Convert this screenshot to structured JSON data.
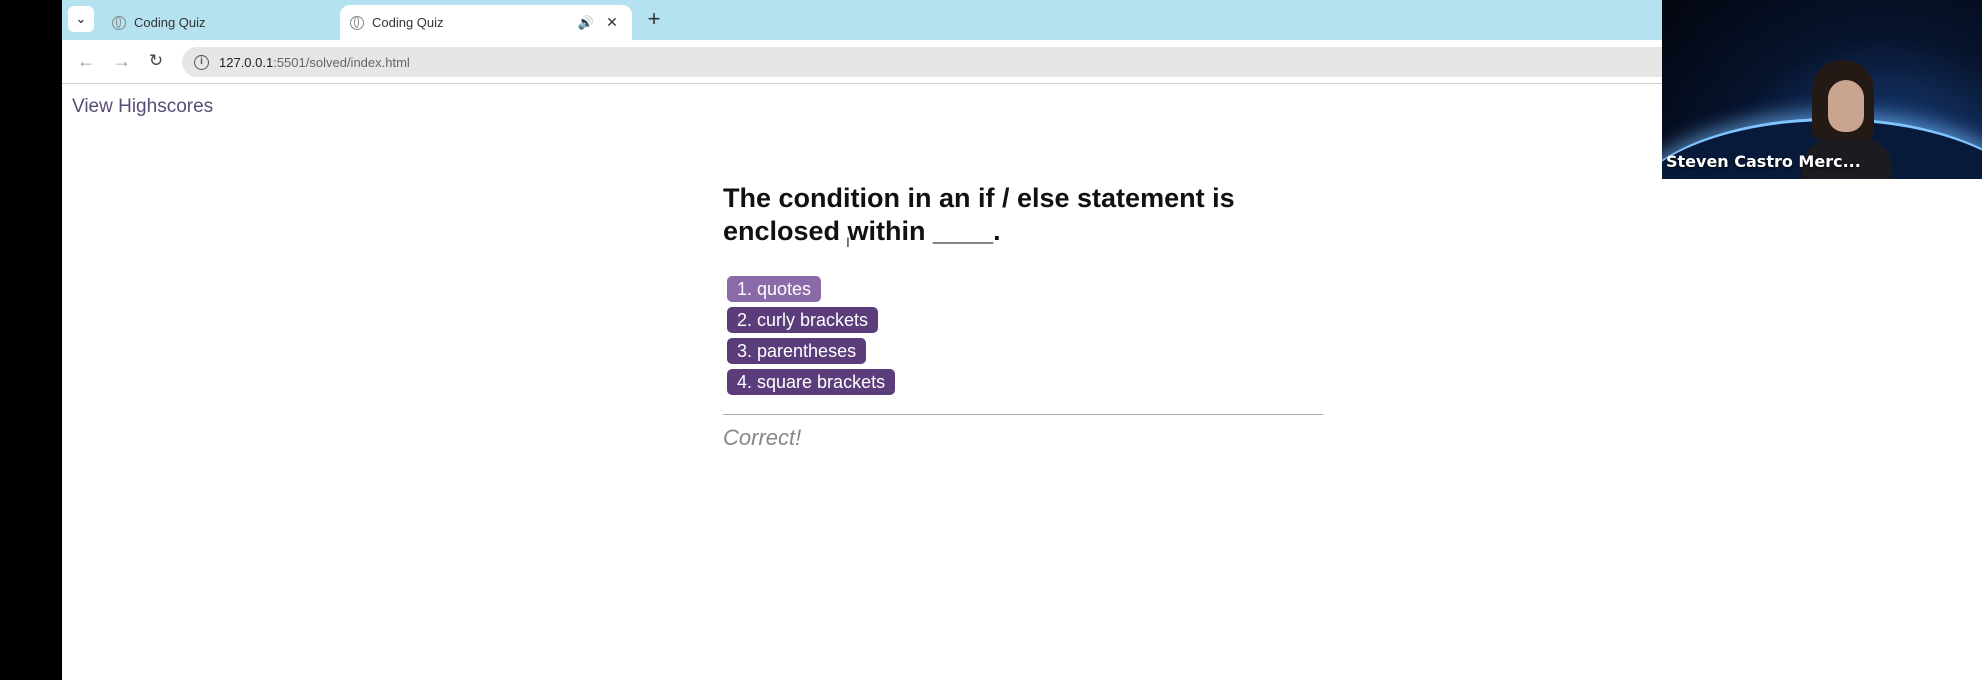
{
  "browser": {
    "tabs": [
      {
        "title": "Coding Quiz",
        "active": false
      },
      {
        "title": "Coding Quiz",
        "active": true
      }
    ],
    "address": {
      "host": "127.0.0.1",
      "path": ":5501/solved/index.html"
    }
  },
  "page": {
    "highscores_link": "View Highscores",
    "question": "The condition in an if / else statement is enclosed within ____.",
    "choices": [
      "1. quotes",
      "2. curly brackets",
      "3. parentheses",
      "4. square brackets"
    ],
    "feedback": "Correct!"
  },
  "webcam": {
    "participant_name": "Steven Castro Merc..."
  },
  "colors": {
    "tabbar": "#b5e2f0",
    "choice_button": "#5a3d7a",
    "choice_hover": "#8a6aa8",
    "link": "#5a4d75"
  }
}
